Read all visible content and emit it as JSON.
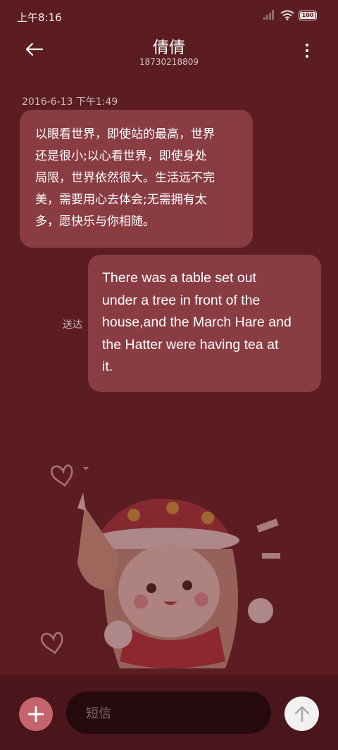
{
  "status_bar": {
    "time": "上午8:16",
    "battery": "100"
  },
  "header": {
    "contact_name": "倩倩",
    "phone_number": "18730218809"
  },
  "conversation": {
    "timestamp": "2016-6-13 下午1:49",
    "messages": [
      {
        "direction": "incoming",
        "lines": [
          "以眼看世界，即使站的最高，世界",
          "还是很小;以心看世界，即使身处",
          "局限，世界依然很大。生活远不完",
          "美，需要用心去体会;无需拥有太",
          "多，愿快乐与你相随。"
        ]
      },
      {
        "direction": "outgoing",
        "status": "送达",
        "lines": [
          "There was a table set out",
          "under a tree in front of the",
          "house,and the March Hare and",
          "the Hatter were having tea at",
          "it."
        ]
      }
    ]
  },
  "composer": {
    "placeholder": "短信"
  },
  "icons": {
    "back": "arrow-left-icon",
    "more": "more-vertical-icon",
    "add": "plus-icon",
    "send": "arrow-up-icon"
  },
  "colors": {
    "background": "#5b1d22",
    "bubble": "#8a3c43",
    "add_button": "#c4646c",
    "input": "#260a0d"
  }
}
